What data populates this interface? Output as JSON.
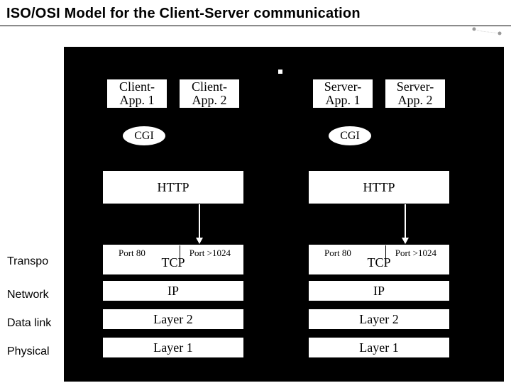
{
  "title": "ISO/OSI Model for the Client-Server communication",
  "side_labels": {
    "transport": "Transpo",
    "network": "Network",
    "datalink": "Data link",
    "physical": "Physical"
  },
  "stations": {
    "client_header": "",
    "server_header": ""
  },
  "client": {
    "app1": "Client-\nApp. 1",
    "app2": "Client-\nApp. 2",
    "cgi": "CGI",
    "http": "HTTP",
    "tcp": {
      "name": "TCP",
      "portLeft": "Port 80",
      "portRight": "Port >1024"
    },
    "ip": "IP",
    "layer2": "Layer 2",
    "layer1": "Layer 1"
  },
  "server": {
    "app1": "Server-\nApp. 1",
    "app2": "Server-\nApp. 2",
    "cgi": "CGI",
    "http": "HTTP",
    "tcp": {
      "name": "TCP",
      "portLeft": "Port 80",
      "portRight": "Port >1024"
    },
    "ip": "IP",
    "layer2": "Layer 2",
    "layer1": "Layer 1"
  }
}
